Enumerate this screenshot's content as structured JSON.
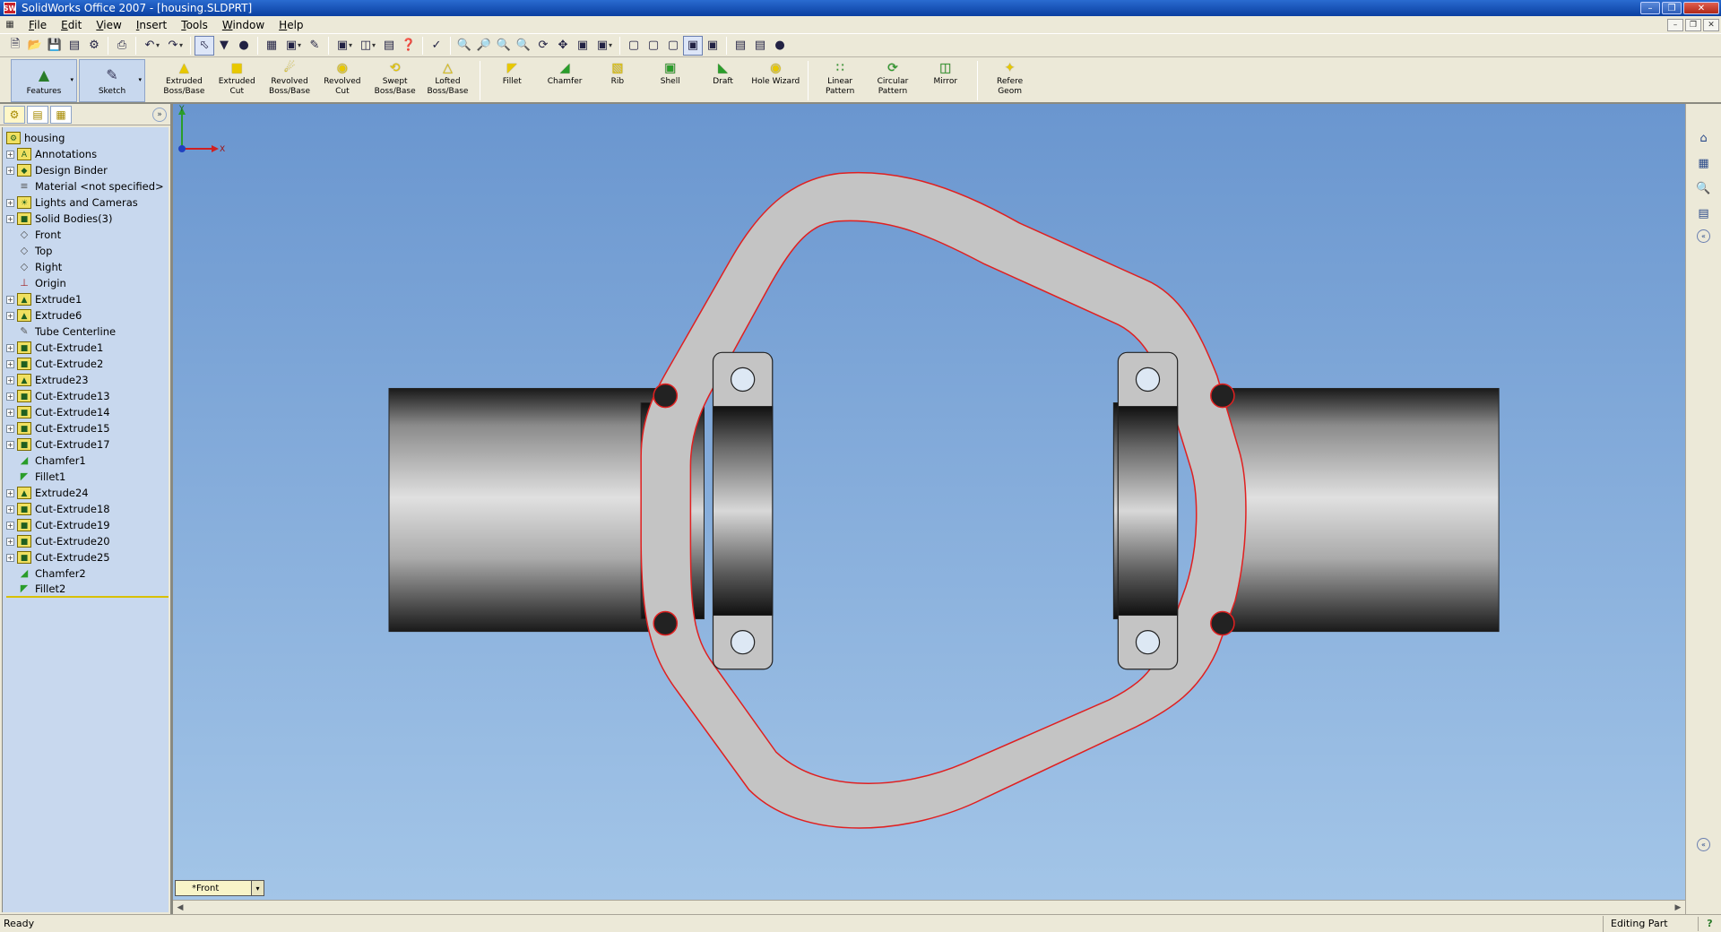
{
  "window": {
    "title": "SolidWorks Office 2007 - [housing.SLDPRT]",
    "app_icon_text": "SW"
  },
  "menus": [
    {
      "label": "File",
      "key": "F",
      "rest": "ile"
    },
    {
      "label": "Edit",
      "key": "E",
      "rest": "dit"
    },
    {
      "label": "View",
      "key": "V",
      "rest": "iew"
    },
    {
      "label": "Insert",
      "key": "I",
      "rest": "nsert"
    },
    {
      "label": "Tools",
      "key": "T",
      "rest": "ools"
    },
    {
      "label": "Window",
      "key": "W",
      "rest": "indow"
    },
    {
      "label": "Help",
      "key": "H",
      "rest": "elp"
    }
  ],
  "command_manager": {
    "tabs": [
      {
        "label": "Features",
        "icon": "features-icon"
      },
      {
        "label": "Sketch",
        "icon": "sketch-icon"
      }
    ],
    "tools": [
      {
        "label": "Extruded Boss/Base",
        "line1": "Extruded",
        "line2": "Boss/Base",
        "icon": "extruded-boss-icon"
      },
      {
        "label": "Extruded Cut",
        "line1": "Extruded Cut",
        "line2": "",
        "icon": "extruded-cut-icon"
      },
      {
        "label": "Revolved Boss/Base",
        "line1": "Revolved",
        "line2": "Boss/Base",
        "icon": "revolved-boss-icon"
      },
      {
        "label": "Revolved Cut",
        "line1": "Revolved Cut",
        "line2": "",
        "icon": "revolved-cut-icon"
      },
      {
        "label": "Swept Boss/Base",
        "line1": "Swept",
        "line2": "Boss/Base",
        "icon": "swept-boss-icon"
      },
      {
        "label": "Lofted Boss/Base",
        "line1": "Lofted",
        "line2": "Boss/Base",
        "icon": "lofted-boss-icon"
      },
      {
        "label": "Fillet",
        "line1": "Fillet",
        "line2": "",
        "icon": "fillet-icon"
      },
      {
        "label": "Chamfer",
        "line1": "Chamfer",
        "line2": "",
        "icon": "chamfer-icon"
      },
      {
        "label": "Rib",
        "line1": "Rib",
        "line2": "",
        "icon": "rib-icon"
      },
      {
        "label": "Shell",
        "line1": "Shell",
        "line2": "",
        "icon": "shell-icon"
      },
      {
        "label": "Draft",
        "line1": "Draft",
        "line2": "",
        "icon": "draft-icon"
      },
      {
        "label": "Hole Wizard",
        "line1": "Hole Wizard",
        "line2": "",
        "icon": "hole-wizard-icon"
      },
      {
        "label": "Linear Pattern",
        "line1": "Linear",
        "line2": "Pattern",
        "icon": "linear-pattern-icon"
      },
      {
        "label": "Circular Pattern",
        "line1": "Circular",
        "line2": "Pattern",
        "icon": "circular-pattern-icon"
      },
      {
        "label": "Mirror",
        "line1": "Mirror",
        "line2": "",
        "icon": "mirror-icon"
      },
      {
        "label": "Reference Geometry",
        "line1": "Refere",
        "line2": "Geom",
        "icon": "reference-geometry-icon"
      }
    ]
  },
  "feature_tree": {
    "root": "housing",
    "items": [
      {
        "label": "Annotations",
        "expand": true,
        "icon": "annotations-icon"
      },
      {
        "label": "Design Binder",
        "expand": true,
        "icon": "design-binder-icon"
      },
      {
        "label": "Material <not specified>",
        "expand": false,
        "icon": "material-icon"
      },
      {
        "label": "Lights and Cameras",
        "expand": true,
        "icon": "lights-icon"
      },
      {
        "label": "Solid Bodies(3)",
        "expand": true,
        "icon": "solid-bodies-icon"
      },
      {
        "label": "Front",
        "expand": false,
        "icon": "plane-icon"
      },
      {
        "label": "Top",
        "expand": false,
        "icon": "plane-icon"
      },
      {
        "label": "Right",
        "expand": false,
        "icon": "plane-icon"
      },
      {
        "label": "Origin",
        "expand": false,
        "icon": "origin-icon"
      },
      {
        "label": "Extrude1",
        "expand": true,
        "icon": "extrude-icon"
      },
      {
        "label": "Extrude6",
        "expand": true,
        "icon": "extrude-icon"
      },
      {
        "label": "Tube Centerline",
        "expand": false,
        "icon": "sketch-icon"
      },
      {
        "label": "Cut-Extrude1",
        "expand": true,
        "icon": "cut-extrude-icon"
      },
      {
        "label": "Cut-Extrude2",
        "expand": true,
        "icon": "cut-extrude-icon"
      },
      {
        "label": "Extrude23",
        "expand": true,
        "icon": "extrude-icon"
      },
      {
        "label": "Cut-Extrude13",
        "expand": true,
        "icon": "cut-extrude-icon"
      },
      {
        "label": "Cut-Extrude14",
        "expand": true,
        "icon": "cut-extrude-icon"
      },
      {
        "label": "Cut-Extrude15",
        "expand": true,
        "icon": "cut-extrude-icon"
      },
      {
        "label": "Cut-Extrude17",
        "expand": true,
        "icon": "cut-extrude-icon"
      },
      {
        "label": "Chamfer1",
        "expand": false,
        "icon": "chamfer-icon"
      },
      {
        "label": "Fillet1",
        "expand": false,
        "icon": "fillet-icon"
      },
      {
        "label": "Extrude24",
        "expand": true,
        "icon": "extrude-icon"
      },
      {
        "label": "Cut-Extrude18",
        "expand": true,
        "icon": "cut-extrude-icon"
      },
      {
        "label": "Cut-Extrude19",
        "expand": true,
        "icon": "cut-extrude-icon"
      },
      {
        "label": "Cut-Extrude20",
        "expand": true,
        "icon": "cut-extrude-icon"
      },
      {
        "label": "Cut-Extrude25",
        "expand": true,
        "icon": "cut-extrude-icon"
      },
      {
        "label": "Chamfer2",
        "expand": false,
        "icon": "chamfer-icon"
      },
      {
        "label": "Fillet2",
        "expand": false,
        "icon": "fillet-icon"
      }
    ]
  },
  "viewport": {
    "view_name": "*Front",
    "triad": {
      "x_label": "X",
      "y_label": "Y"
    },
    "colors": {
      "background_top": "#6a96cf",
      "background_bottom": "#a4c6e8",
      "edge_highlight": "#e02020",
      "flange": "#c4c4c4"
    }
  },
  "status": {
    "message": "Ready",
    "mode": "Editing Part",
    "help": "?"
  }
}
